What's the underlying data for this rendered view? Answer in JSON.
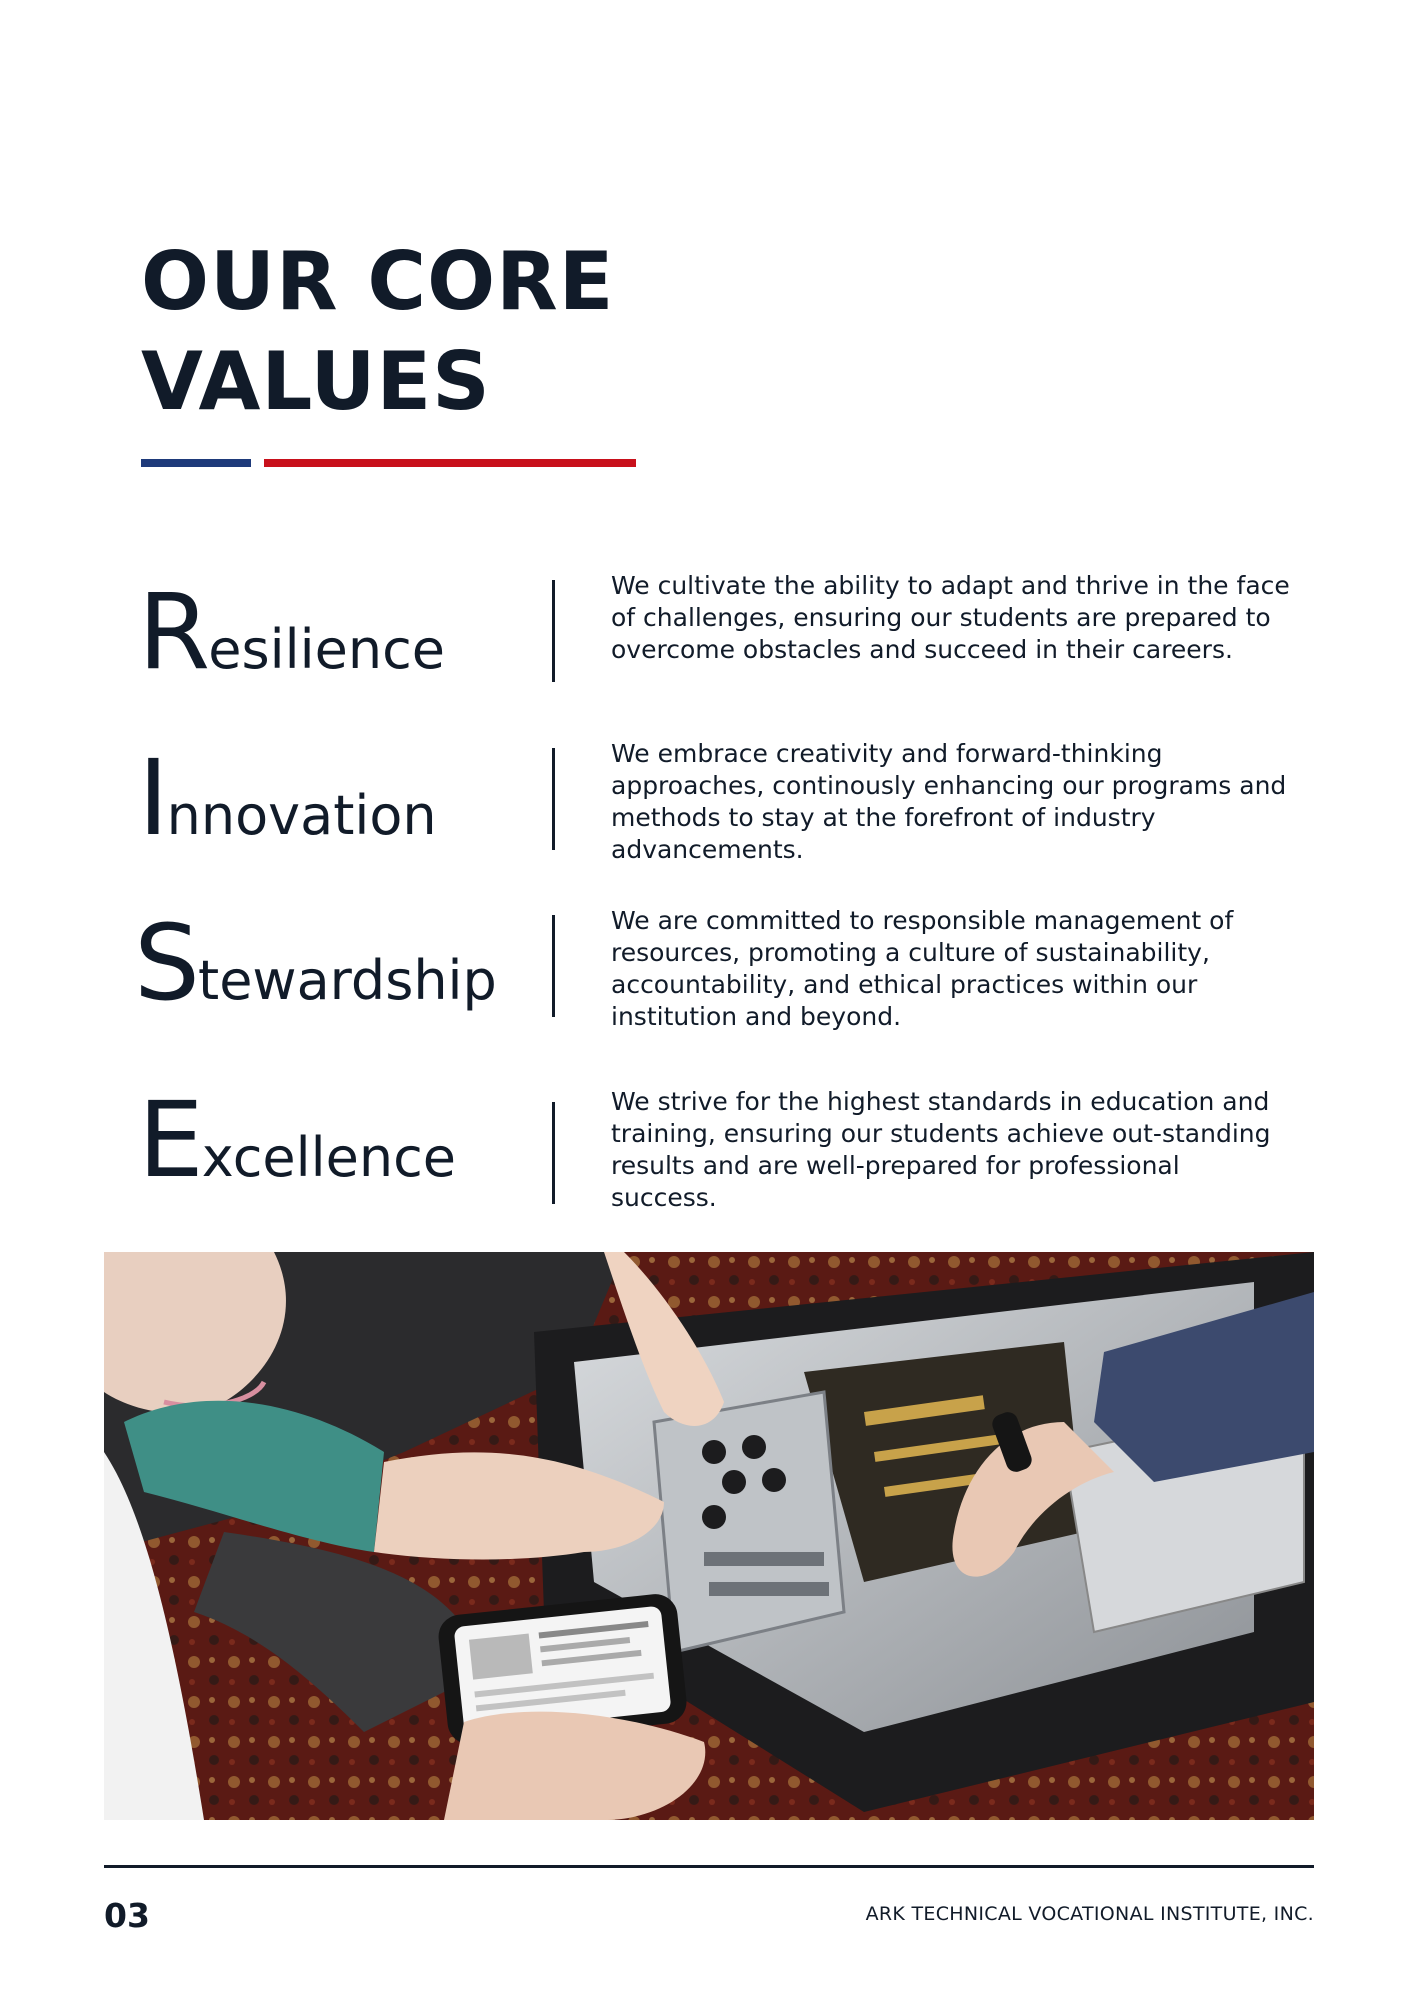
{
  "page": {
    "title_line1": "OUR CORE",
    "title_line2": "VALUES"
  },
  "values": [
    {
      "initial": "R",
      "rest": "esilience",
      "description": "We cultivate the ability to adapt and thrive in the face of challenges, ensuring our students are prepared to overcome obstacles and succeed in their careers."
    },
    {
      "initial": "I",
      "rest": "nnovation",
      "description": "We embrace creativity and forward-thinking approaches, continously enhancing our programs and methods to stay at the forefront of industry advancements."
    },
    {
      "initial": "S",
      "rest": "tewardship",
      "description": "We are committed to responsible management of resources, promoting a culture of sustainability, accountability, and ethical practices within our institution and beyond."
    },
    {
      "initial": "E",
      "rest": "xcellence",
      "description": "We strive for the highest standards in education and training, ensuring our students achieve out-standing results and are well-prepared for professional success."
    }
  ],
  "footer": {
    "page_number": "03",
    "organization": "ARK TECHNICAL VOCATIONAL INSTITUTE, INC."
  },
  "colors": {
    "text": "#111b29",
    "accent_blue": "#1e3a7a",
    "accent_red": "#c8101b"
  }
}
